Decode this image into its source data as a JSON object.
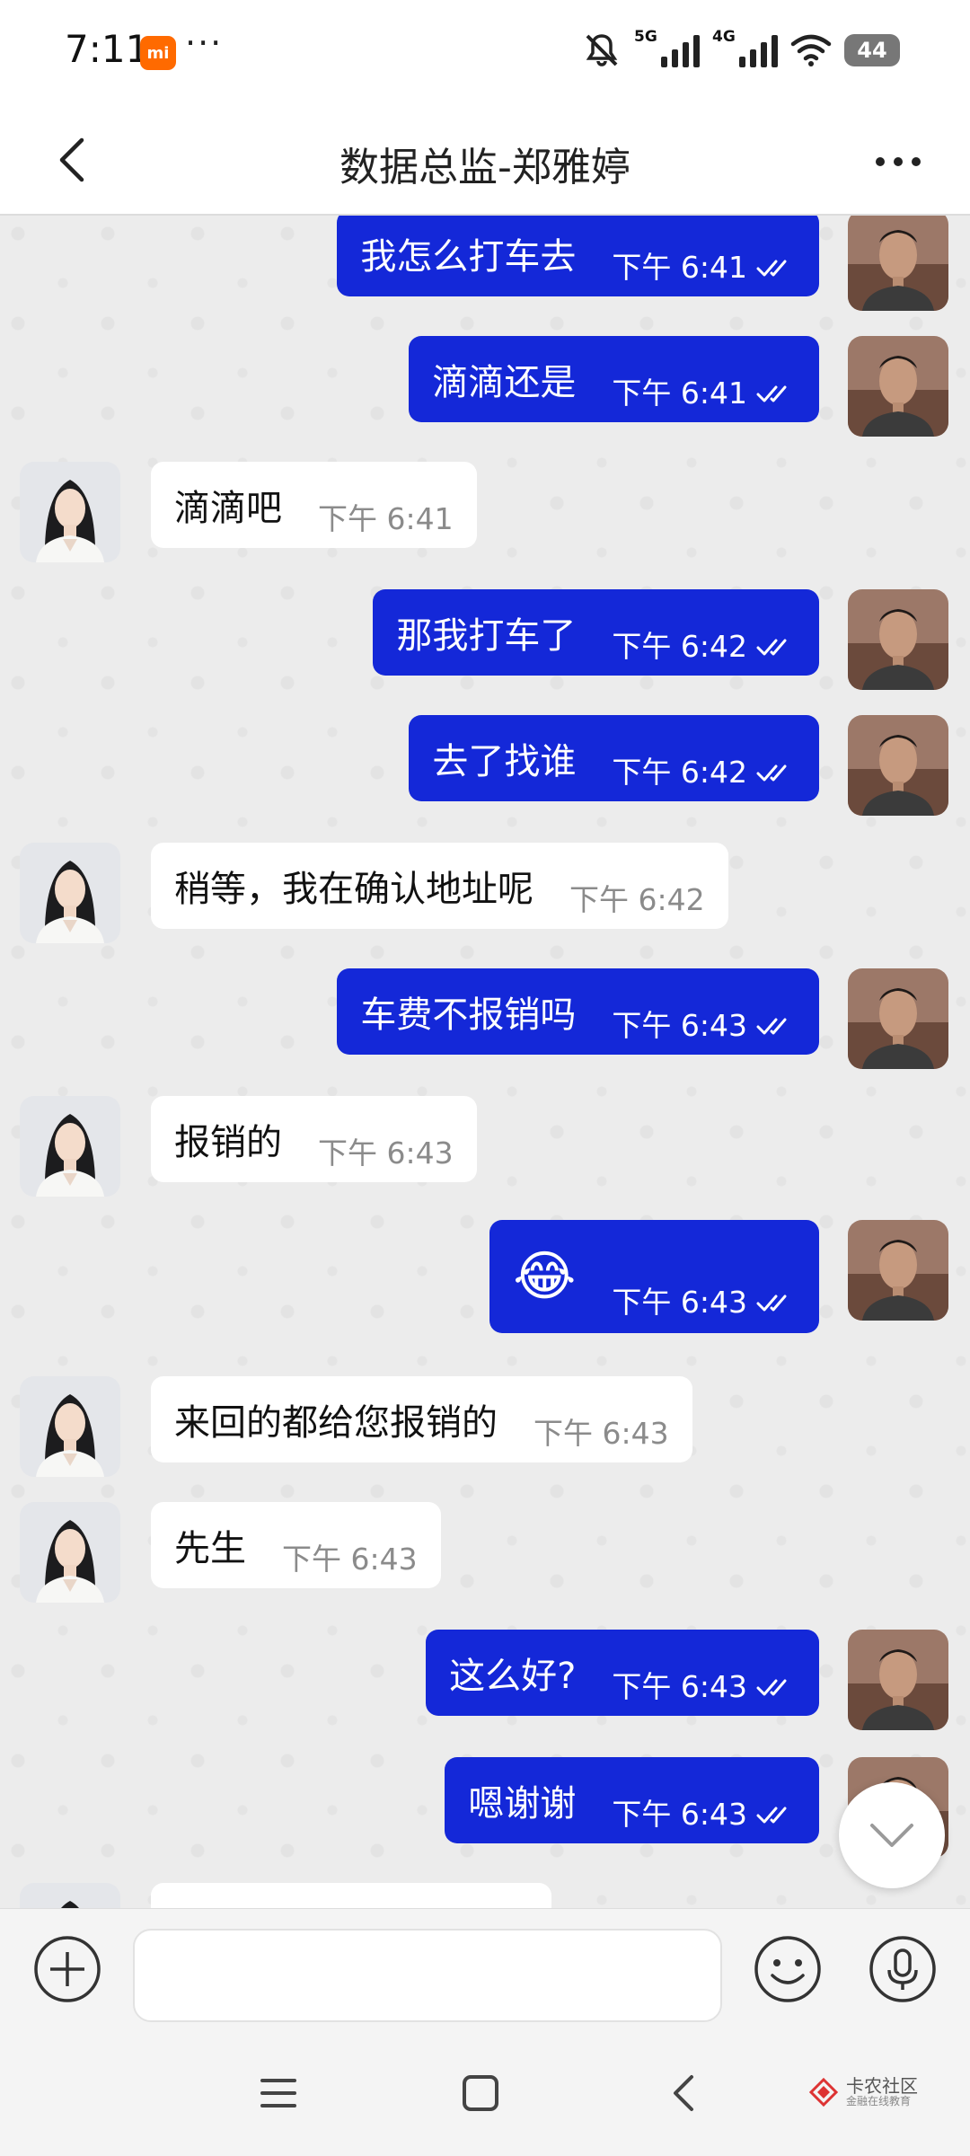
{
  "status_bar": {
    "time": "7:11",
    "mi_badge": "mi",
    "overflow": "···",
    "net_5g": "5G",
    "net_4g": "4G",
    "battery": "44",
    "icons": [
      "mute-bell-icon",
      "signal-5g-icon",
      "signal-4g-icon",
      "wifi-icon",
      "battery-icon"
    ]
  },
  "header": {
    "title": "数据总监-郑雅婷",
    "back_icon": "chevron-left-icon",
    "more_icon": "more-horizontal-icon"
  },
  "messages": [
    {
      "side": "out",
      "text": "我怎么打车去",
      "time": "下午 6:41",
      "read": true
    },
    {
      "side": "out",
      "text": "滴滴还是",
      "time": "下午 6:41",
      "read": true
    },
    {
      "side": "in",
      "text": "滴滴吧",
      "time": "下午 6:41"
    },
    {
      "side": "out",
      "text": "那我打车了",
      "time": "下午 6:42",
      "read": true
    },
    {
      "side": "out",
      "text": "去了找谁",
      "time": "下午 6:42",
      "read": true
    },
    {
      "side": "in",
      "text": "稍等，我在确认地址呢",
      "time": "下午 6:42"
    },
    {
      "side": "out",
      "text": "车费不报销吗",
      "time": "下午 6:43",
      "read": true
    },
    {
      "side": "in",
      "text": "报销的",
      "time": "下午 6:43"
    },
    {
      "side": "out",
      "text": "😂",
      "time": "下午 6:43",
      "read": true,
      "emoji": true
    },
    {
      "side": "in",
      "text": "来回的都给您报销的",
      "time": "下午 6:43"
    },
    {
      "side": "in",
      "text": "先生",
      "time": "下午 6:43"
    },
    {
      "side": "out",
      "text": "这么好?",
      "time": "下午 6:43",
      "read": true
    },
    {
      "side": "out",
      "text": "嗯谢谢",
      "time": "下午 6:43",
      "read": true
    }
  ],
  "input_bar": {
    "value": "",
    "attach_icon": "plus-circle-icon",
    "emoji_icon": "smiley-icon",
    "voice_icon": "microphone-icon"
  },
  "nav_bar": {
    "icons": [
      "menu-icon",
      "home-square-icon",
      "back-chevron-icon"
    ]
  },
  "watermark": {
    "main": "卡农社区",
    "sub": "金融在线教育"
  },
  "colors": {
    "outgoing_bubble": "#1428d8",
    "incoming_bubble": "#ffffff",
    "chat_background": "#ececec",
    "mi_badge": "#ff6a00"
  }
}
